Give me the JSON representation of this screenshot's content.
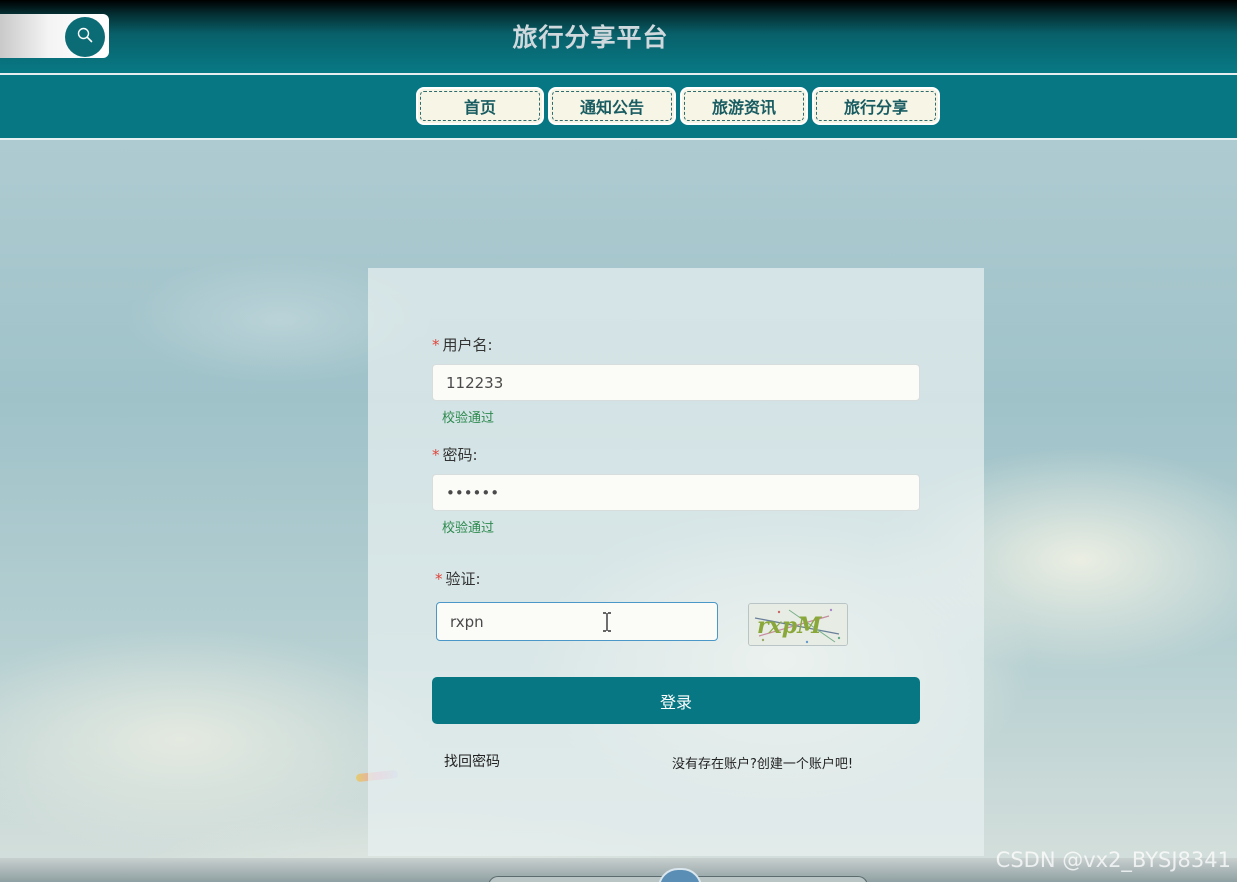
{
  "header": {
    "site_title": "旅行分享平台",
    "search_icon": "search-icon"
  },
  "nav": {
    "items": [
      {
        "label": "首页"
      },
      {
        "label": "通知公告"
      },
      {
        "label": "旅游资讯"
      },
      {
        "label": "旅行分享"
      }
    ]
  },
  "login_form": {
    "username": {
      "required_mark": "*",
      "label": "用户名:",
      "value": "112233",
      "validation": "校验通过"
    },
    "password": {
      "required_mark": "*",
      "label": "密码:",
      "value": "••••••",
      "validation": "校验通过"
    },
    "captcha": {
      "required_mark": "*",
      "label": "验证:",
      "value": "rxpn",
      "image_text": "rxpM"
    },
    "login_button": "登录",
    "forgot_password_link": "找回密码",
    "register_link": "没有存在账户?创建一个账户吧!"
  },
  "watermark": "CSDN @vx2_BYSJ8341",
  "colors": {
    "primary": "#077783",
    "valid": "#2d8a4e",
    "required": "#e0453b"
  }
}
